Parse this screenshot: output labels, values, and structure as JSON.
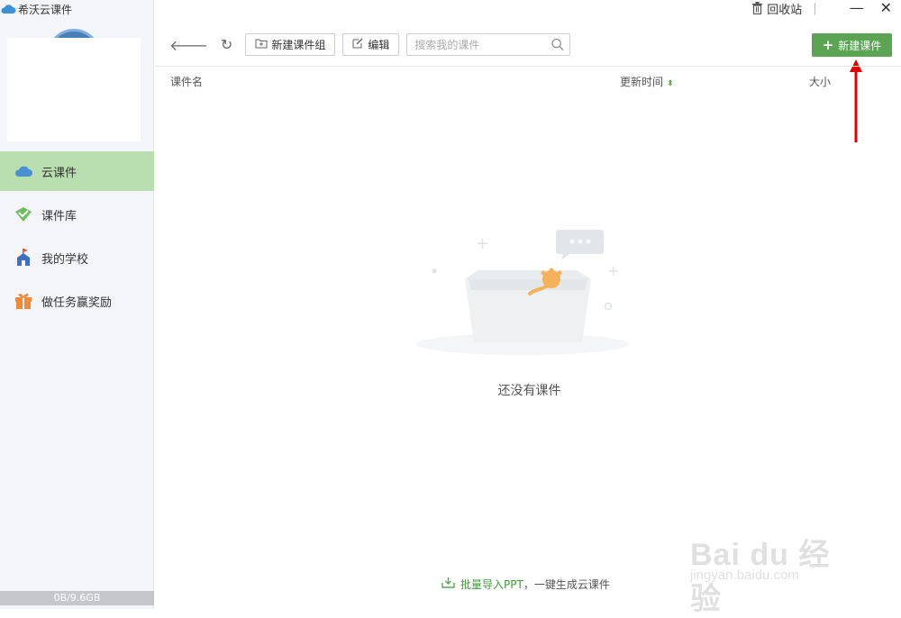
{
  "app": {
    "title": "希沃云课件"
  },
  "sidebar": {
    "items": [
      {
        "label": "云课件",
        "icon": "cloud-icon",
        "active": true
      },
      {
        "label": "课件库",
        "icon": "library-icon",
        "active": false
      },
      {
        "label": "我的学校",
        "icon": "school-icon",
        "active": false
      },
      {
        "label": "做任务赢奖励",
        "icon": "gift-icon",
        "active": false
      }
    ],
    "storage": "0B/9.6GB"
  },
  "window": {
    "recycle_label": "回收站",
    "minimize_icon": "minimize-icon",
    "close_icon": "close-icon"
  },
  "toolbar": {
    "new_group_label": "新建课件组",
    "edit_label": "编辑",
    "search_placeholder": "搜索我的课件",
    "new_courseware_label": "新建课件"
  },
  "table": {
    "columns": [
      "课件名",
      "更新时间",
      "大小"
    ]
  },
  "empty": {
    "text": "还没有课件"
  },
  "footer": {
    "import_link": "批量导入PPT",
    "import_suffix": "，一键生成云课件"
  },
  "watermark": {
    "line1": "Bai du 经验",
    "line2": "jingyan.baidu.com"
  },
  "colors": {
    "accent": "#5aa454",
    "active_bg": "#b9dfb0",
    "arrow": "#e00000"
  }
}
